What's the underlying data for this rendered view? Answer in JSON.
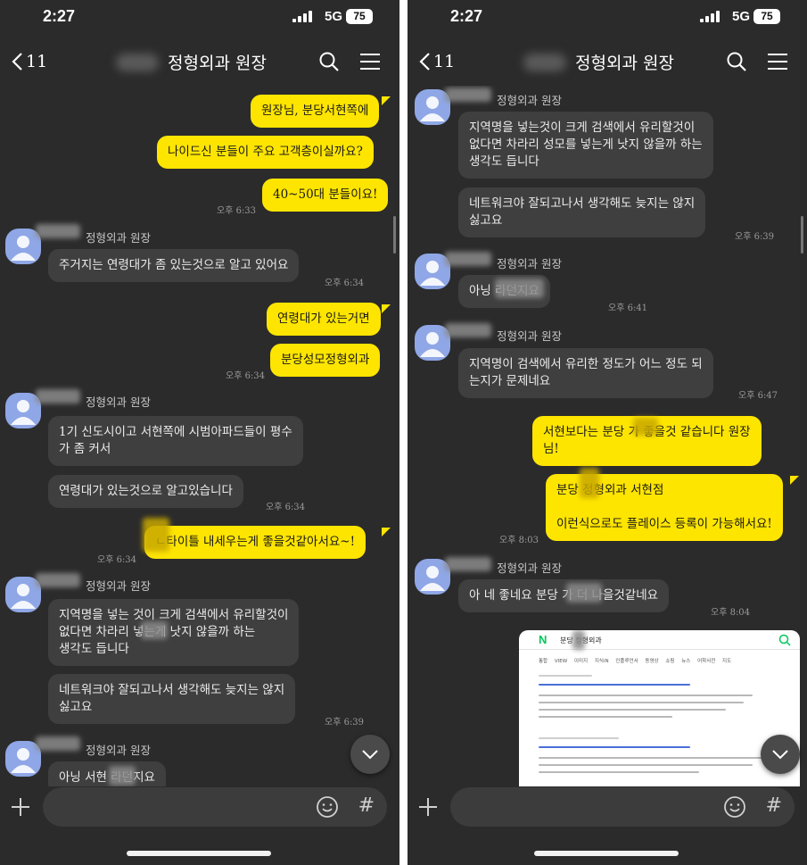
{
  "status_bar": {
    "time": "2:27",
    "network": "5G",
    "battery": "75"
  },
  "nav": {
    "back_count": "11",
    "title": "정형외과 원장"
  },
  "left": {
    "m1": "원장님, 분당서현쪽에",
    "m2": "나이드신 분들이 주요 고객층이실까요?",
    "m3": "40~50대 분들이요!",
    "t1": "오후 6:33",
    "s1": "정형외과 원장",
    "m4": "주거지는 연령대가 좀 있는것으로 알고 있어요",
    "t2": "오후 6:34",
    "m5": "연령대가 있는거면",
    "m6": "분당성모정형외과",
    "t3": "오후 6:34",
    "s2": "정형외과 원장",
    "m7": "1기 신도시이고 서현쪽에 시범아파드들이 평수\n가 좀 커서",
    "m8": "연령대가 있는것으로 알고있습니다",
    "t4": "오후 6:34",
    "m9": "  ㄴ타이틀 내세우는게 좋을것같아서요~!",
    "t5": "오후 6:34",
    "s3": "정형외과 원장",
    "m10": "지역명을 넣는 것이 크게 검색에서 유리할것이\n없다면 차라리           넣는게 낫지 않을까 하는\n생각도 듭니다",
    "m11": "네트워크야 잘되고나서 생각해도 늦지는 않지\n싫고요",
    "t6": "오후 6:39",
    "s4": "정형외과 원장",
    "m12": "아닝 서현     라던지요"
  },
  "right": {
    "s1": "정형외과 원장",
    "m1": "지역명을 넣는것이 크게 검색에서 유리할것이\n없다면 차라리 성모를 넣는게 낫지 않을까 하는\n생각도 듭니다",
    "m2": "네트워크야 잘되고나서 생각해도 늦지는 않지\n싫고요",
    "t1": "오후 6:39",
    "s2": "정형외과 원장",
    "m3": "아닝           라던지요",
    "t2": "오후 6:41",
    "s3": "정형외과 원장",
    "m4": "지역명이 검색에서 유리한 정도가 어느 정도 되\n는지가 문제네요",
    "t3": "오후 6:47",
    "m5": "서현보다는 분당      가 좋을것 같습니다 원장\n님!",
    "m6": "분당       정형외과 서현점\n\n이런식으로도 플레이스 등록이 가능해서요!",
    "t4": "오후 8:03",
    "s4": "정형외과 원장",
    "m7": "아 네 좋네요 분당        가 더 나을것같네요",
    "t5": "오후 8:04",
    "shot": {
      "logo": "N",
      "query": "분당      정형외과",
      "tabs": "통합 VIEW 이미지 지식iN 인플루언서 동영상 쇼핑 뉴스 어학사전 지도"
    }
  },
  "colors": {
    "background": "#2b2b2b",
    "my_bubble": "#fee500",
    "other_bubble": "#3f3f3f",
    "avatar": "#8fa7e6"
  }
}
